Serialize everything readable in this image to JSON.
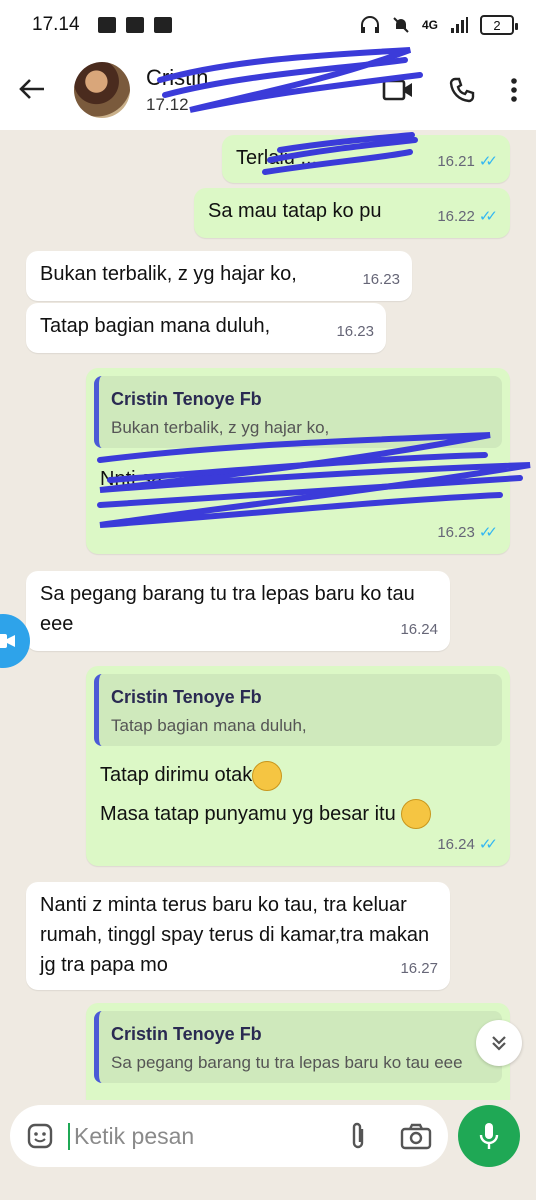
{
  "status_bar": {
    "time": "17.14",
    "network": "4G",
    "battery": "2"
  },
  "header": {
    "contact_name": "Cristin",
    "last_seen": "17.12"
  },
  "messages": [
    {
      "dir": "out",
      "text": "Terlalu ...",
      "time": "16.21"
    },
    {
      "dir": "out",
      "text": "Sa mau tatap ko pu",
      "time": "16.22"
    },
    {
      "dir": "in",
      "text": "Bukan terbalik, z yg hajar ko,",
      "time": "16.23"
    },
    {
      "dir": "in",
      "text": "Tatap bagian mana duluh,",
      "time": "16.23"
    },
    {
      "dir": "out",
      "quote_name": "Cristin Tenoye Fb",
      "quote_text": "Bukan terbalik, z yg hajar ko,",
      "text": "Nnti sa ...",
      "time": "16.23"
    },
    {
      "dir": "in",
      "text": "Sa pegang barang tu tra lepas baru ko tau eee",
      "time": "16.24"
    },
    {
      "dir": "out",
      "quote_name": "Cristin Tenoye Fb",
      "quote_text": "Tatap bagian mana duluh,",
      "text": "Tatap dirimu otak",
      "text2": "Masa tatap punyamu yg besar itu",
      "time": "16.24"
    },
    {
      "dir": "in",
      "text": "Nanti z minta terus baru ko tau, tra keluar rumah, tinggl spay terus di kamar,tra makan jg tra papa mo",
      "time": "16.27"
    },
    {
      "dir": "out",
      "quote_name": "Cristin Tenoye Fb",
      "quote_text": "Sa pegang barang tu tra lepas baru ko tau eee"
    }
  ],
  "composer": {
    "placeholder": "Ketik pesan"
  },
  "icons": {
    "back": "arrow-left-icon",
    "video": "video-call-icon",
    "call": "phone-icon",
    "menu": "more-vert-icon",
    "emoji": "emoji-icon",
    "attach": "paperclip-icon",
    "camera": "camera-icon",
    "mic": "mic-icon",
    "scroll": "chevron-double-down-icon"
  },
  "colors": {
    "outgoing": "#dcf8c6",
    "incoming": "#ffffff",
    "accent": "#1fa855",
    "read_tick": "#34b7f1",
    "quote_bar": "#4b5bd6"
  }
}
